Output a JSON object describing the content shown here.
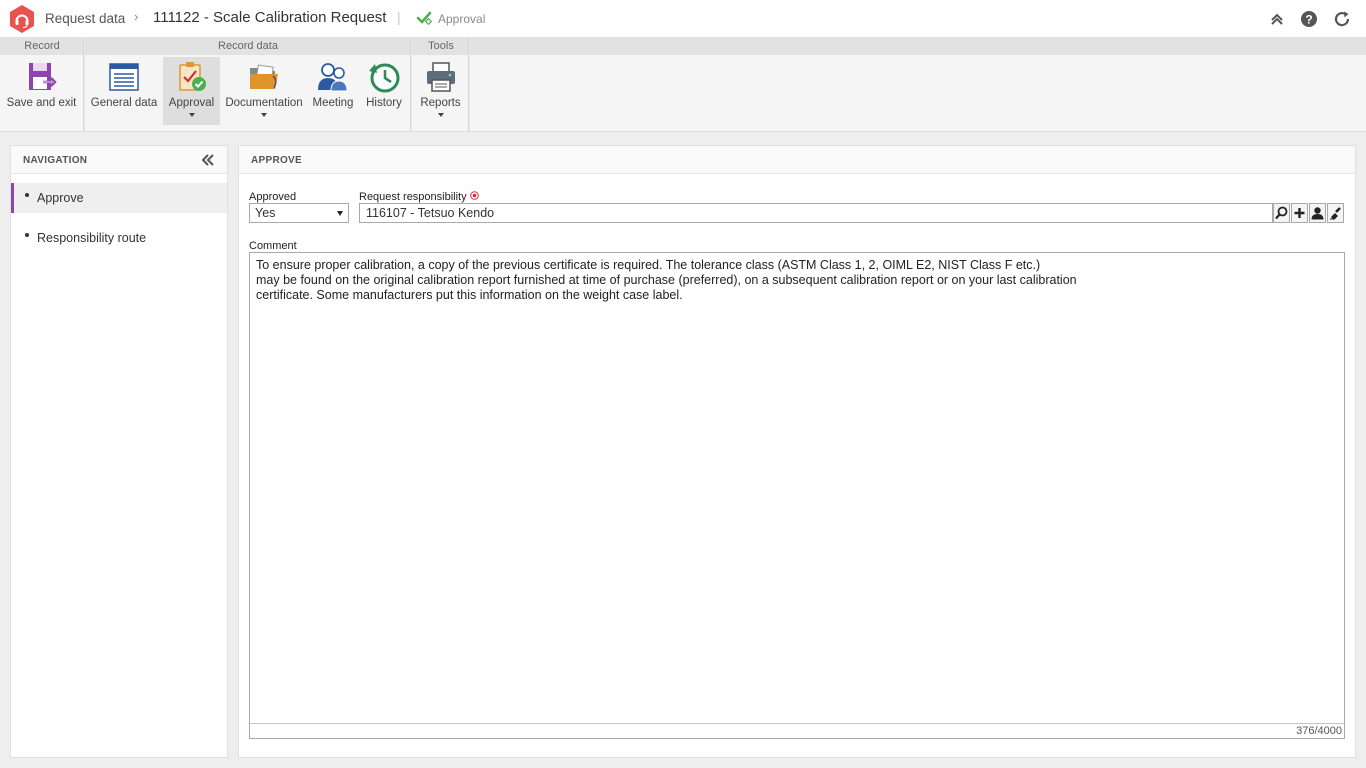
{
  "titlebar": {
    "module": "Request data",
    "record_title": "111122 - Scale Calibration Request",
    "step": "Approval",
    "icons": [
      "logo-icon",
      "chevron-right-icon",
      "approval-check-icon",
      "collapse-up-icon",
      "help-icon",
      "refresh-icon"
    ]
  },
  "ribbon": {
    "groups": {
      "record": "Record",
      "record_data": "Record data",
      "tools": "Tools"
    },
    "buttons": {
      "save_exit": "Save and exit",
      "general_data": "General data",
      "approval": "Approval",
      "documentation": "Documentation",
      "meeting": "Meeting",
      "history": "History",
      "reports": "Reports"
    }
  },
  "navigation": {
    "title": "NAVIGATION",
    "items": [
      {
        "label": "Approve",
        "selected": true
      },
      {
        "label": "Responsibility route",
        "selected": false
      }
    ]
  },
  "main": {
    "title": "APPROVE",
    "approved": {
      "label": "Approved",
      "value": "Yes"
    },
    "request_responsibility": {
      "label": "Request responsibility",
      "value": "116107 - Tetsuo Kendo",
      "required": true
    },
    "comment": {
      "label": "Comment",
      "text": "To ensure proper calibration, a copy of the previous certificate is required. The tolerance class (ASTM Class 1, 2, OIML E2, NIST Class F etc.)\nmay be found on the original calibration report furnished at time of purchase (preferred), on a subsequent calibration report or on your last calibration\ncertificate. Some manufacturers put this information on the weight case label.",
      "counter": "376/4000"
    }
  },
  "colors": {
    "brand": "#e8524f",
    "accent_purple": "#8e44ad",
    "approval_green": "#4caf50",
    "history_green": "#2e8b57",
    "required_red": "#d32f2f"
  }
}
